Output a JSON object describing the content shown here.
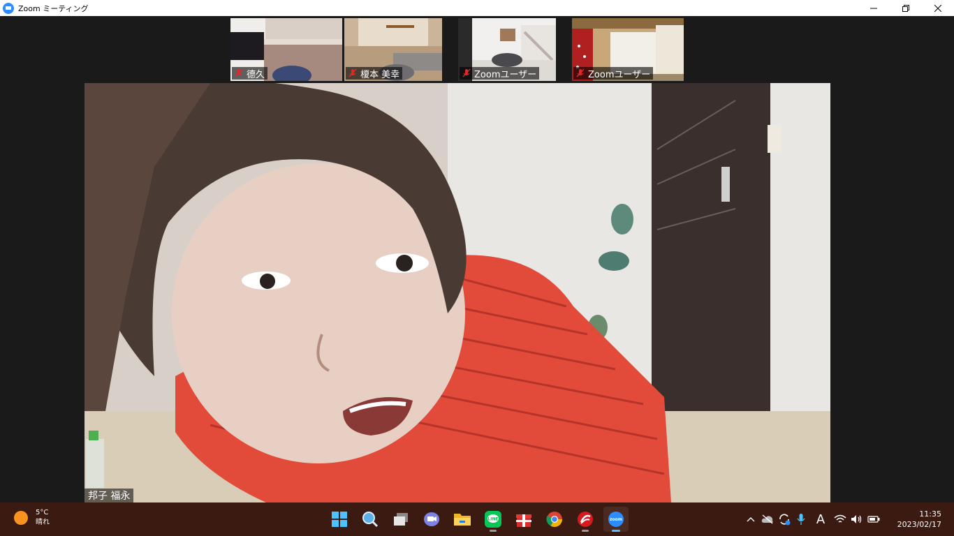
{
  "window": {
    "title": "Zoom ミーティング"
  },
  "thumbnails": [
    {
      "name": "德久",
      "muted": true
    },
    {
      "name": "榎本 美幸",
      "muted": true
    },
    {
      "name": "Zoomユーザー",
      "muted": true
    },
    {
      "name": "Zoomユーザー",
      "muted": true
    }
  ],
  "main_video": {
    "name": "邦子 福永"
  },
  "taskbar": {
    "weather": {
      "temp": "5°C",
      "condition": "晴れ"
    },
    "apps": [
      "start-icon",
      "search-icon",
      "task-view-icon",
      "teams-chat-icon",
      "file-explorer-icon",
      "line-icon",
      "gift-icon",
      "chrome-icon",
      "antivirus-icon",
      "zoom-icon"
    ],
    "tray": {
      "ime": "A"
    },
    "clock": {
      "time": "11:35",
      "date": "2023/02/17"
    }
  },
  "colors": {
    "taskbar": "#3b1a12",
    "zoom_blue": "#2d8cff",
    "muted_red": "#e02828"
  }
}
